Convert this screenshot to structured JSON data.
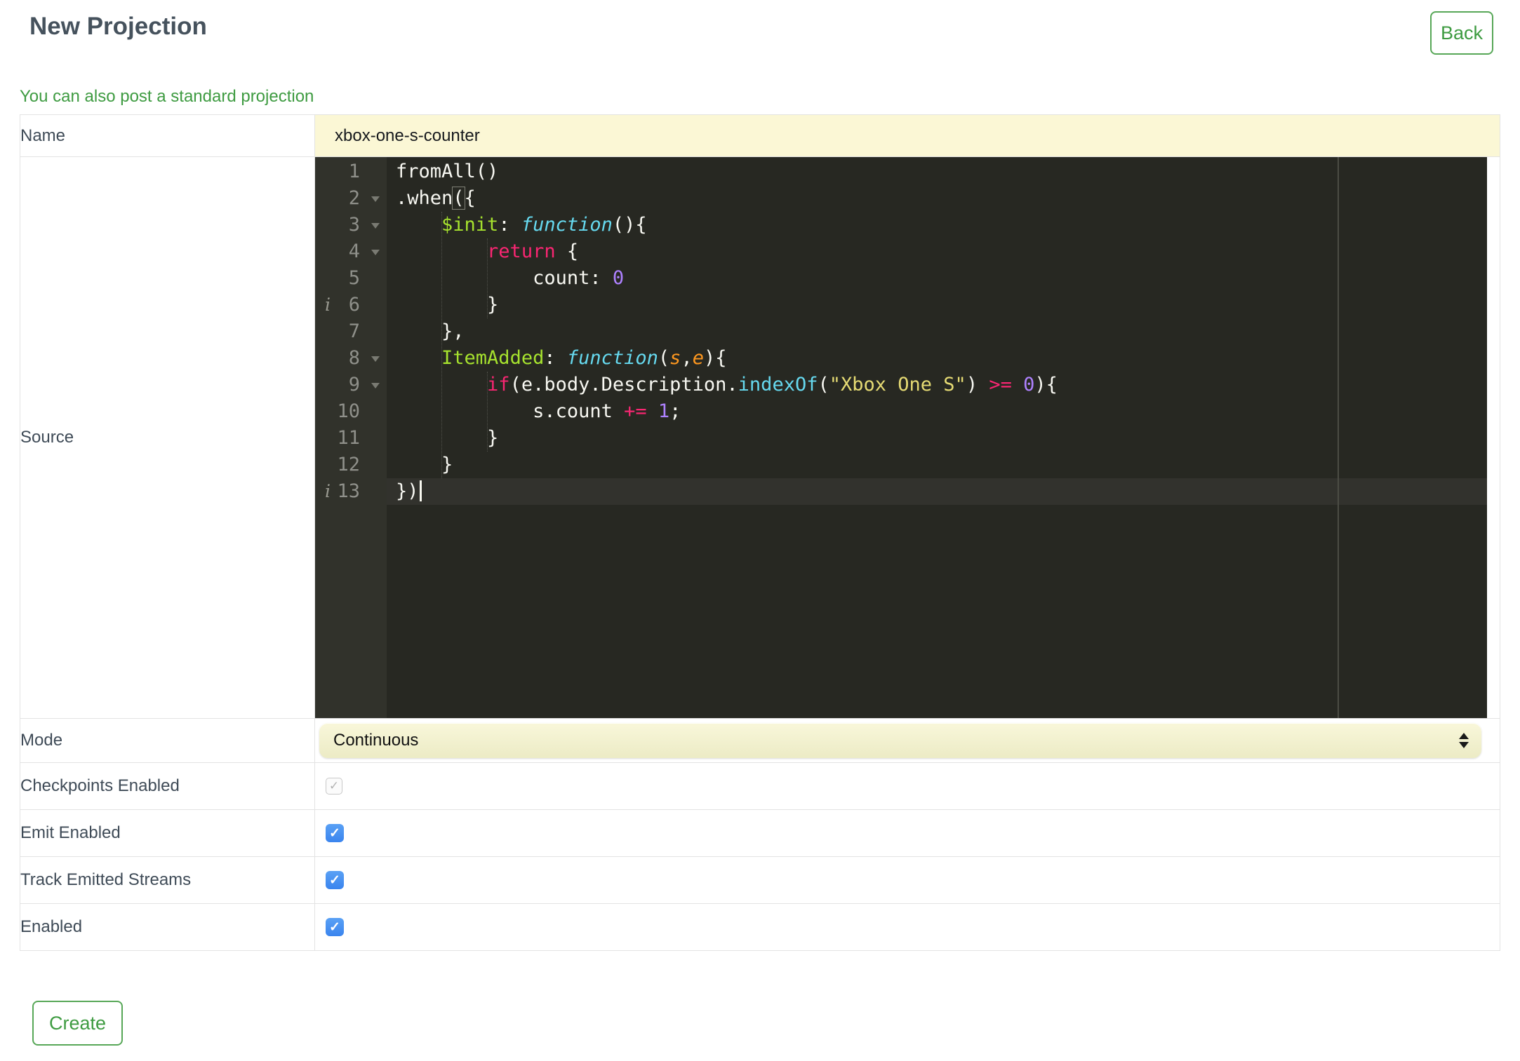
{
  "page": {
    "title": "New Projection",
    "back_label": "Back",
    "link_text": "You can also post a standard projection",
    "create_label": "Create"
  },
  "colors": {
    "accent_green": "#449c44",
    "input_yellow": "#fbf7d5",
    "label_slate": "#3f4b57",
    "checkbox_blue": "#478ff0"
  },
  "form": {
    "name": {
      "label": "Name",
      "value": "xbox-one-s-counter"
    },
    "source": {
      "label": "Source"
    },
    "mode": {
      "label": "Mode",
      "value": "Continuous"
    },
    "checkboxes": [
      {
        "label": "Checkpoints Enabled",
        "checked": true,
        "disabled": true
      },
      {
        "label": "Emit Enabled",
        "checked": true,
        "disabled": false
      },
      {
        "label": "Track Emitted Streams",
        "checked": true,
        "disabled": false
      },
      {
        "label": "Enabled",
        "checked": true,
        "disabled": false
      }
    ]
  },
  "editor": {
    "colors": {
      "background": "#272822",
      "gutter_background": "#31322b",
      "line_number": "#8f908a",
      "text": "#f8f8f2",
      "keyword": "#f92672",
      "property": "#a6e22e",
      "function_keyword": "#66d9ef",
      "support_function": "#66d9ef",
      "string": "#e6db74",
      "number": "#ae81ff",
      "argument": "#fd971f"
    },
    "lines": [
      {
        "n": 1,
        "tokens": [
          [
            "p",
            "fromAll()"
          ]
        ]
      },
      {
        "n": 2,
        "fold": true,
        "tokens": [
          [
            "p",
            ".when"
          ],
          [
            "bm",
            "("
          ],
          [
            "p",
            "{"
          ]
        ]
      },
      {
        "n": 3,
        "fold": true,
        "tokens": [
          [
            "p",
            "    "
          ],
          [
            "key",
            "$init"
          ],
          [
            "p",
            ": "
          ],
          [
            "fnkw",
            "function"
          ],
          [
            "p",
            "(){"
          ]
        ]
      },
      {
        "n": 4,
        "fold": true,
        "tokens": [
          [
            "p",
            "        "
          ],
          [
            "kw",
            "return"
          ],
          [
            "p",
            " {"
          ]
        ]
      },
      {
        "n": 5,
        "tokens": [
          [
            "p",
            "            count: "
          ],
          [
            "num",
            "0"
          ]
        ]
      },
      {
        "n": 6,
        "info": true,
        "tokens": [
          [
            "p",
            "        }"
          ]
        ]
      },
      {
        "n": 7,
        "tokens": [
          [
            "p",
            "    },"
          ]
        ]
      },
      {
        "n": 8,
        "fold": true,
        "tokens": [
          [
            "p",
            "    "
          ],
          [
            "key",
            "ItemAdded"
          ],
          [
            "p",
            ": "
          ],
          [
            "fnkw",
            "function"
          ],
          [
            "p",
            "("
          ],
          [
            "arg",
            "s"
          ],
          [
            "p",
            ","
          ],
          [
            "arg",
            "e"
          ],
          [
            "p",
            "){"
          ]
        ]
      },
      {
        "n": 9,
        "fold": true,
        "tokens": [
          [
            "p",
            "        "
          ],
          [
            "kw",
            "if"
          ],
          [
            "p",
            "(e.body.Description."
          ],
          [
            "sup",
            "indexOf"
          ],
          [
            "p",
            "("
          ],
          [
            "str",
            "\"Xbox One S\""
          ],
          [
            "p",
            ") "
          ],
          [
            "kw",
            ">="
          ],
          [
            "p",
            " "
          ],
          [
            "num",
            "0"
          ],
          [
            "p",
            "){"
          ]
        ]
      },
      {
        "n": 10,
        "tokens": [
          [
            "p",
            "            s.count "
          ],
          [
            "kw",
            "+="
          ],
          [
            "p",
            " "
          ],
          [
            "num",
            "1"
          ],
          [
            "p",
            ";"
          ]
        ]
      },
      {
        "n": 11,
        "tokens": [
          [
            "p",
            "        }"
          ]
        ]
      },
      {
        "n": 12,
        "tokens": [
          [
            "p",
            "    }"
          ]
        ]
      },
      {
        "n": 13,
        "info": true,
        "active": true,
        "cursor": true,
        "tokens": [
          [
            "p",
            "})"
          ]
        ]
      }
    ]
  }
}
